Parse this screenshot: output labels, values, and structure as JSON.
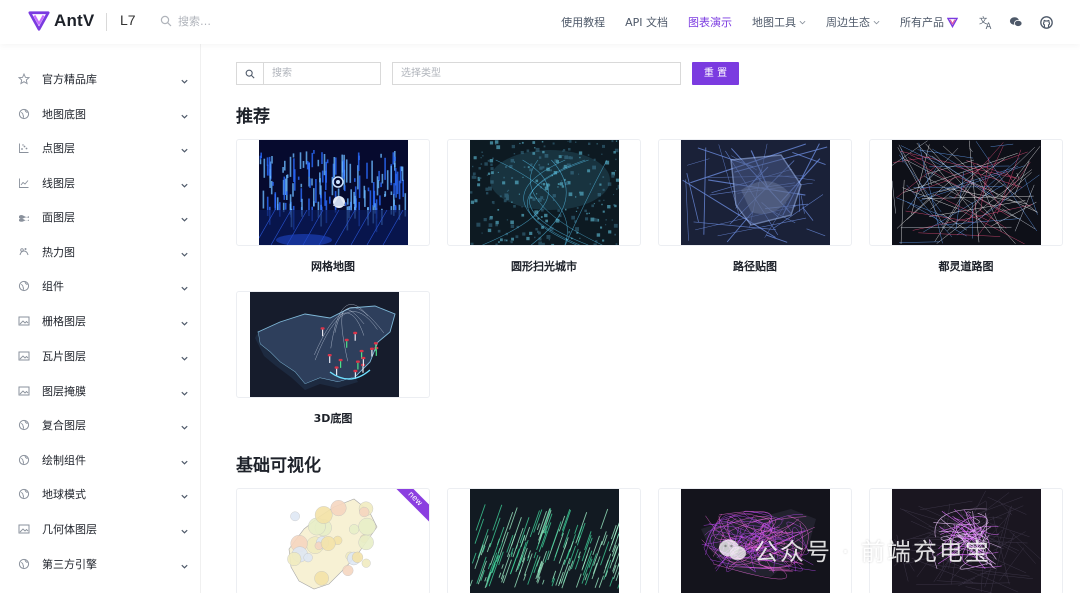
{
  "header": {
    "logo_text": "AntV",
    "product": "L7",
    "search_placeholder": "搜索…",
    "nav": [
      {
        "label": "使用教程",
        "dropdown": false,
        "active": false
      },
      {
        "label": "API 文档",
        "dropdown": false,
        "active": false
      },
      {
        "label": "图表演示",
        "dropdown": false,
        "active": true
      },
      {
        "label": "地图工具",
        "dropdown": true,
        "active": false
      },
      {
        "label": "周边生态",
        "dropdown": true,
        "active": false
      },
      {
        "label": "所有产品",
        "dropdown": false,
        "active": false
      }
    ],
    "icons": [
      "translate-icon",
      "wechat-icon",
      "github-icon"
    ]
  },
  "sidebar": {
    "items": [
      {
        "label": "官方精品库",
        "icon": "star-icon"
      },
      {
        "label": "地图底图",
        "icon": "globe-icon"
      },
      {
        "label": "点图层",
        "icon": "scatter-icon"
      },
      {
        "label": "线图层",
        "icon": "line-chart-icon"
      },
      {
        "label": "面图层",
        "icon": "area-icon"
      },
      {
        "label": "热力图",
        "icon": "heat-icon"
      },
      {
        "label": "组件",
        "icon": "globe-icon"
      },
      {
        "label": "栅格图层",
        "icon": "image-icon"
      },
      {
        "label": "瓦片图层",
        "icon": "image-icon"
      },
      {
        "label": "图层掩膜",
        "icon": "image-icon"
      },
      {
        "label": "复合图层",
        "icon": "globe-icon"
      },
      {
        "label": "绘制组件",
        "icon": "globe-icon"
      },
      {
        "label": "地球模式",
        "icon": "globe-icon"
      },
      {
        "label": "几何体图层",
        "icon": "image-icon"
      },
      {
        "label": "第三方引擎",
        "icon": "globe-icon"
      }
    ]
  },
  "filters": {
    "search_placeholder": "搜索",
    "select_placeholder": "选择类型",
    "reset_label": "重 置"
  },
  "sections": [
    {
      "title": "推荐",
      "cards": [
        {
          "label": "网格地图",
          "thumb": "blue-grid-map"
        },
        {
          "label": "圆形扫光城市",
          "thumb": "city-scan"
        },
        {
          "label": "路径贴图",
          "thumb": "path-texture"
        },
        {
          "label": "都灵道路图",
          "thumb": "turin-roads"
        },
        {
          "label": "3D底图",
          "thumb": "china-3d"
        }
      ]
    },
    {
      "title": "基础可视化",
      "cards": [
        {
          "label": "",
          "thumb": "fujian-map",
          "badge": "new"
        },
        {
          "label": "",
          "thumb": "green-bars"
        },
        {
          "label": "",
          "thumb": "purple-lines"
        },
        {
          "label": "",
          "thumb": "pink-network"
        }
      ]
    }
  ],
  "watermark": "公众号 · 前端充电宝",
  "colors": {
    "accent": "#7b3be0",
    "text": "#1d2129",
    "muted": "#b0b4bb"
  }
}
